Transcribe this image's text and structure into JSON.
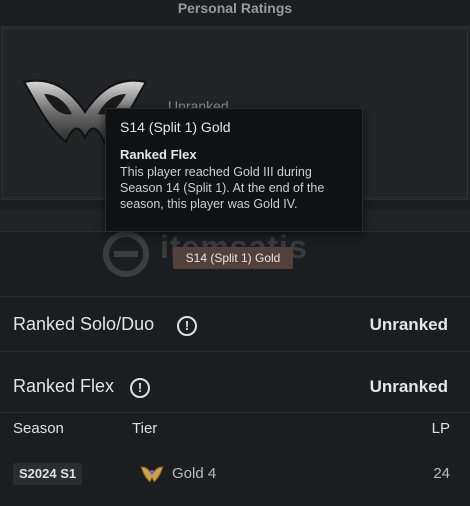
{
  "header": {
    "title": "Personal Ratings"
  },
  "panel": {
    "hidden_label": "Unranked"
  },
  "tooltip": {
    "title": "S14 (Split 1) Gold",
    "subtitle": "Ranked Flex",
    "body": "This player reached Gold III during Season 14 (Split 1). At the end of the season, this player was Gold IV."
  },
  "badge": {
    "label": "S14 (Split 1) Gold"
  },
  "watermark": {
    "text": "itemsatis"
  },
  "queues": [
    {
      "label": "Ranked Solo/Duo",
      "status": "Unranked"
    },
    {
      "label": "Ranked Flex",
      "status": "Unranked"
    }
  ],
  "table": {
    "headers": {
      "season": "Season",
      "tier": "Tier",
      "lp": "LP"
    },
    "rows": [
      {
        "season": "S2024 S1",
        "tier": "Gold 4",
        "lp": "24"
      }
    ]
  },
  "colors": {
    "gold": "#c8a34a",
    "badge_bg": "#51413a"
  }
}
